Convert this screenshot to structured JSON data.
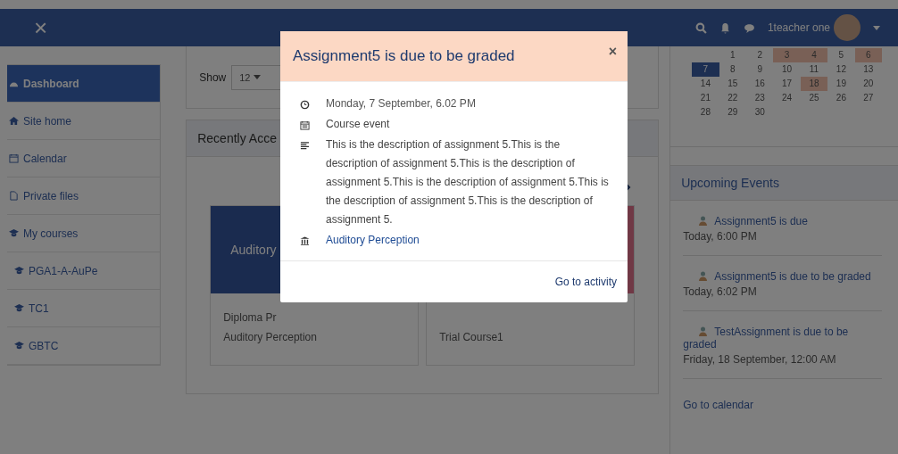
{
  "navbar": {
    "close_icon": "×",
    "user_name": "1teacher one"
  },
  "sidebar": {
    "items": [
      {
        "label": "Dashboard",
        "selected": true
      },
      {
        "label": "Site home",
        "selected": false
      },
      {
        "label": "Calendar",
        "selected": false
      },
      {
        "label": "Private files",
        "selected": false
      },
      {
        "label": "My courses",
        "selected": false,
        "children": [
          {
            "label": "PGA1-A-AuPe",
            "selected": false
          },
          {
            "label": "TC1",
            "selected": false
          },
          {
            "label": "GBTC",
            "selected": false
          }
        ]
      }
    ]
  },
  "main": {
    "show_label": "Show",
    "show_value": "12",
    "recently_accessed": {
      "title": "Recently Acce",
      "courses": [
        {
          "image_text": "Auditory",
          "category": "Diploma Pr",
          "name": "Auditory Perception"
        },
        {
          "name": "Trial Course1"
        }
      ]
    }
  },
  "calendar": {
    "weeks": [
      [
        {
          "day": "1",
          "event": false,
          "today": false
        },
        {
          "day": "2",
          "event": false,
          "today": false
        },
        {
          "day": "3",
          "event": true,
          "today": false
        },
        {
          "day": "4",
          "event": true,
          "today": false
        },
        {
          "day": "5",
          "event": false,
          "today": false
        },
        {
          "day": "6",
          "event": true,
          "today": false
        }
      ],
      [
        {
          "day": "7",
          "event": false,
          "today": true
        },
        {
          "day": "8",
          "event": false,
          "today": false
        },
        {
          "day": "9",
          "event": false,
          "today": false
        },
        {
          "day": "10",
          "event": false,
          "today": false
        },
        {
          "day": "11",
          "event": false,
          "today": false
        },
        {
          "day": "12",
          "event": false,
          "today": false
        },
        {
          "day": "13",
          "event": false,
          "today": false
        }
      ],
      [
        {
          "day": "14",
          "event": false,
          "today": false
        },
        {
          "day": "15",
          "event": false,
          "today": false
        },
        {
          "day": "16",
          "event": false,
          "today": false
        },
        {
          "day": "17",
          "event": false,
          "today": false
        },
        {
          "day": "18",
          "event": true,
          "today": false
        },
        {
          "day": "19",
          "event": false,
          "today": false
        },
        {
          "day": "20",
          "event": false,
          "today": false
        }
      ],
      [
        {
          "day": "21",
          "event": false,
          "today": false
        },
        {
          "day": "22",
          "event": false,
          "today": false
        },
        {
          "day": "23",
          "event": false,
          "today": false
        },
        {
          "day": "24",
          "event": false,
          "today": false
        },
        {
          "day": "25",
          "event": false,
          "today": false
        },
        {
          "day": "26",
          "event": false,
          "today": false
        },
        {
          "day": "27",
          "event": false,
          "today": false
        }
      ],
      [
        {
          "day": "28",
          "event": false,
          "today": false
        },
        {
          "day": "29",
          "event": false,
          "today": false
        },
        {
          "day": "30",
          "event": false,
          "today": false
        }
      ]
    ]
  },
  "upcoming_events": {
    "title": "Upcoming Events",
    "events": [
      {
        "title": "Assignment5 is due",
        "time": "Today, 6:00 PM"
      },
      {
        "title": "Assignment5 is due to be graded",
        "time": "Today, 6:02 PM"
      },
      {
        "title": "TestAssignment is due to be graded",
        "time": "Friday, 18 September, 12:00 AM"
      }
    ],
    "footer_link": "Go to calendar"
  },
  "modal": {
    "title": "Assignment5 is due to be graded",
    "close": "×",
    "details": [
      {
        "kind": "time",
        "text": "Monday, 7 September, 6.02 PM"
      },
      {
        "kind": "type",
        "text": "Course event"
      },
      {
        "kind": "description",
        "text": "This is the description of assignment 5.This is the description of assignment 5.This is the description of assignment 5.This is the description of assignment 5.This is the description of assignment 5.This is the description of assignment 5."
      },
      {
        "kind": "course",
        "text": "Auditory Perception"
      }
    ],
    "action": "Go to activity"
  }
}
